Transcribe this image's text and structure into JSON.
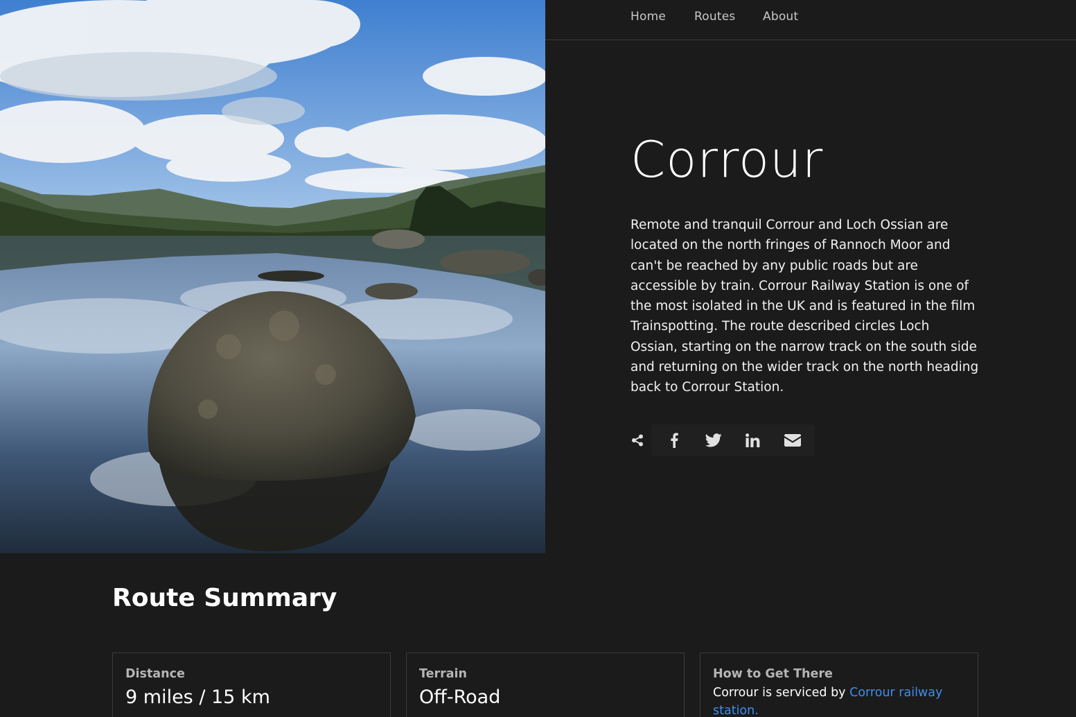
{
  "nav": {
    "items": [
      {
        "label": "Home"
      },
      {
        "label": "Routes"
      },
      {
        "label": "About"
      }
    ]
  },
  "hero": {
    "title": "Corrour",
    "description": "Remote and tranquil Corrour and Loch Ossian are located on the north fringes of Rannoch Moor and can't be reached by any public roads but are accessible by train. Corrour Railway Station is one of the most isolated in the UK and is featured in the film Trainspotting. The route described circles Loch Ossian, starting on the narrow track on the south side and returning on the wider track on the north heading back to Corrour Station."
  },
  "share": {
    "icons": [
      "share-icon",
      "facebook-icon",
      "twitter-icon",
      "linkedin-icon",
      "envelope-icon"
    ]
  },
  "summary": {
    "title": "Route Summary",
    "cards": [
      {
        "label": "Distance",
        "value": "9 miles / 15 km"
      },
      {
        "label": "Terrain",
        "value": "Off-Road"
      },
      {
        "label": "How to Get There",
        "text": "Corrour is serviced by ",
        "link_text": "Corrour railway station."
      }
    ]
  },
  "colors": {
    "background": "#1b1b1b",
    "link": "#3d8ff0",
    "nav_text": "#c8c8c8"
  }
}
